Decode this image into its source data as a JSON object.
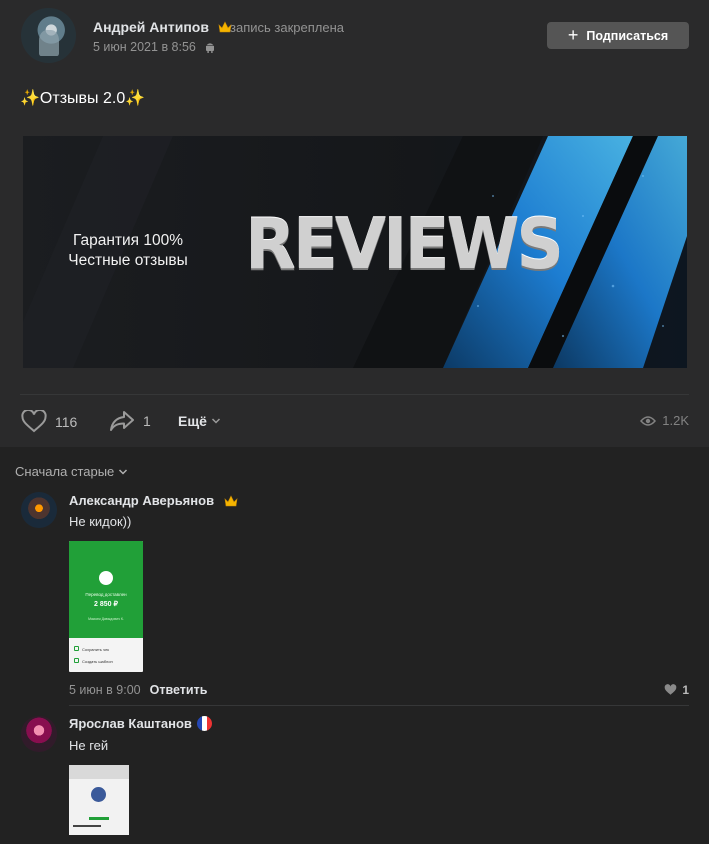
{
  "post": {
    "author": "Андрей Антипов",
    "pinned_label": "запись закреплена",
    "date": "5 июн 2021 в 8:56",
    "subscribe_label": "Подписаться",
    "text": "Отзывы 2.0",
    "sparkle": "✨",
    "banner": {
      "line1": "Гарантия 100%",
      "line2": "Честные отзывы",
      "title": "REVIEWS"
    },
    "likes": "116",
    "shares": "1",
    "more_label": "Ещё",
    "views": "1.2K"
  },
  "comments_sort": "Сначала старые",
  "comments": [
    {
      "author": "Александр Аверьянов",
      "text": "Не кидок))",
      "attachment": {
        "title": "Перевод доставлен",
        "amount": "2 850 ₽",
        "recipient": "Максим Давыдович К.",
        "row1": "Сохранить чек",
        "row2": "Создать шаблон"
      },
      "date": "5 июн в 9:00",
      "reply_label": "Ответить",
      "likes": "1"
    },
    {
      "author": "Ярослав Каштанов",
      "text": "Не гей"
    }
  ],
  "colors": {
    "background": "#222222",
    "card": "#2a2a2b",
    "button": "#555555",
    "accent_blue": "#1e88e5",
    "sber_green": "#21a038"
  },
  "icons": [
    "crown-icon",
    "android-icon",
    "plus-icon",
    "heart-icon",
    "share-icon",
    "chevron-down-icon",
    "eye-icon",
    "flag-icon"
  ]
}
